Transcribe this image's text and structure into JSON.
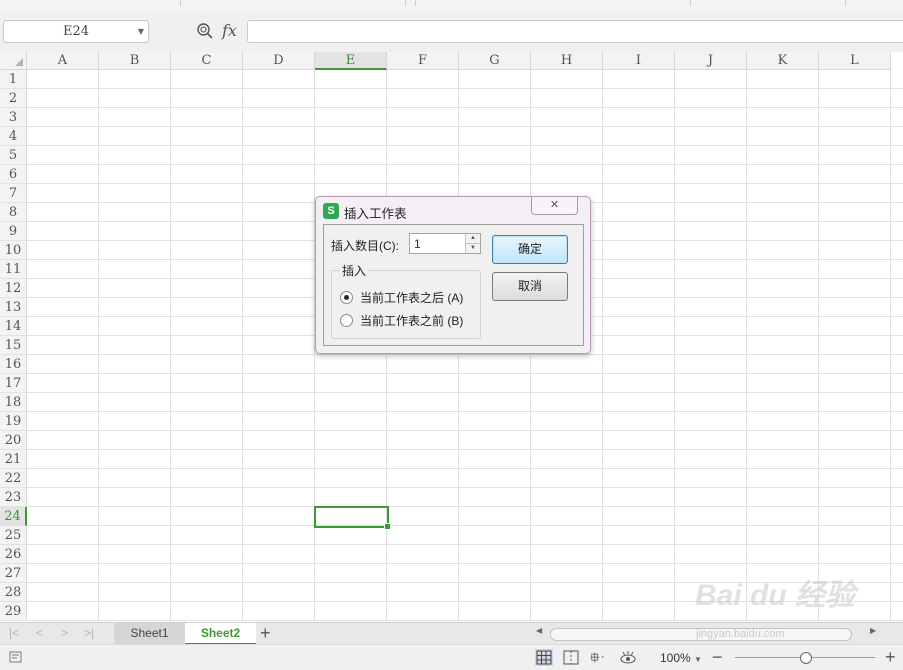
{
  "formula_bar": {
    "name_box": "E24",
    "fx_label": "fx"
  },
  "columns": [
    "A",
    "B",
    "C",
    "D",
    "E",
    "F",
    "G",
    "H",
    "I",
    "J",
    "K",
    "L"
  ],
  "active_column": "E",
  "rows": [
    "1",
    "2",
    "3",
    "4",
    "5",
    "6",
    "7",
    "8",
    "9",
    "10",
    "11",
    "12",
    "13",
    "14",
    "15",
    "16",
    "17",
    "18",
    "19",
    "20",
    "21",
    "22",
    "23",
    "24",
    "25",
    "26",
    "27",
    "28",
    "29"
  ],
  "active_row": "24",
  "dialog": {
    "title": "插入工作表",
    "logo": "S",
    "count_label": "插入数目(C):",
    "count_value": "1",
    "group_label": "插入",
    "option_after": "当前工作表之后 (A)",
    "option_before": "当前工作表之前 (B)",
    "selected_option": "after",
    "ok_label": "确定",
    "cancel_label": "取消"
  },
  "sheet_tabs": [
    {
      "label": "Sheet1",
      "active": false
    },
    {
      "label": "Sheet2",
      "active": true
    }
  ],
  "status_bar": {
    "zoom": "100%"
  },
  "watermark": {
    "brand": "Bai du 经验",
    "url": "jingyan.baidu.com"
  },
  "colors": {
    "accent": "#3a9a33",
    "dialog_frame": "#b89bb2",
    "primary_button": "#3c7fb1"
  }
}
